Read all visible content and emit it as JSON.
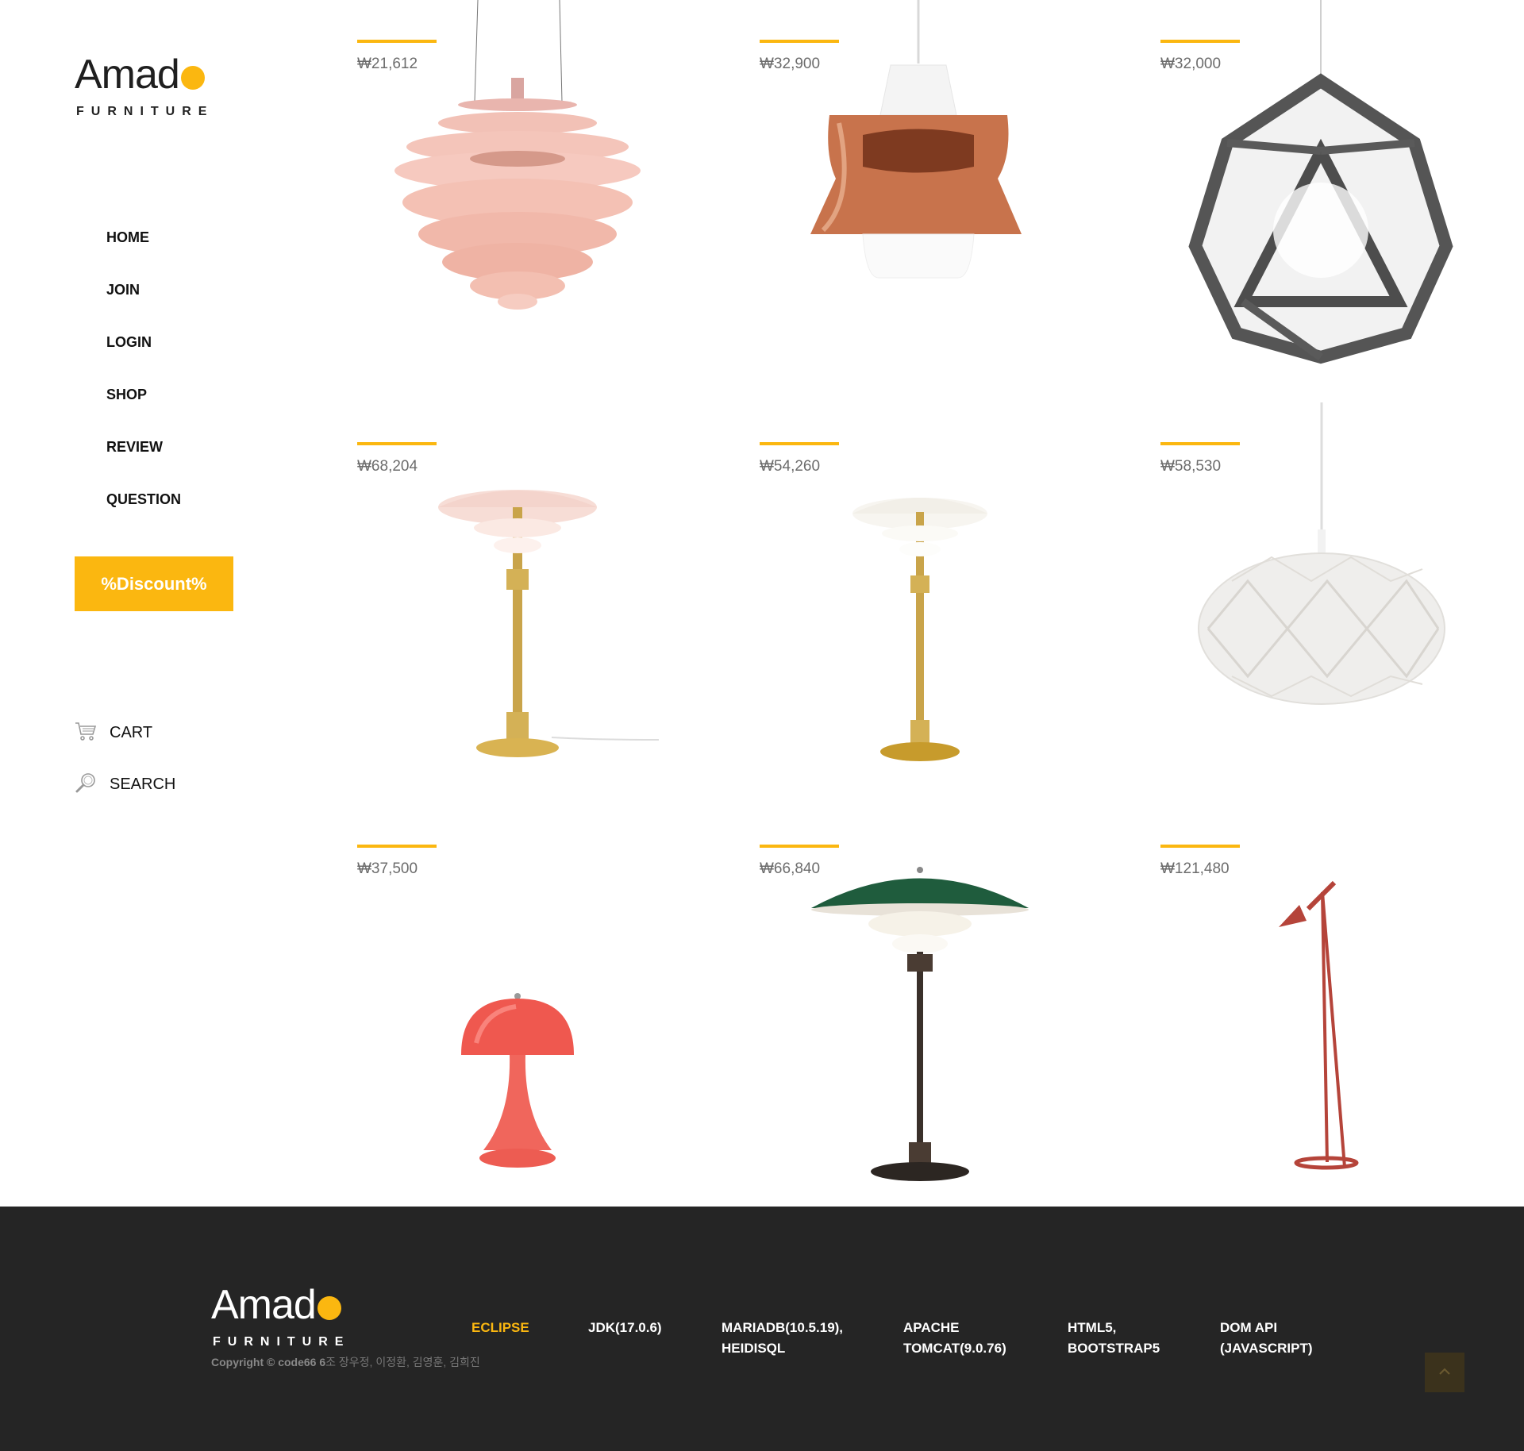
{
  "brand": {
    "name": "Amad",
    "tagline": "FURNITURE",
    "accent": "#fbb710"
  },
  "nav": {
    "items": [
      {
        "label": "HOME"
      },
      {
        "label": "JOIN"
      },
      {
        "label": "LOGIN"
      },
      {
        "label": "SHOP"
      },
      {
        "label": "REVIEW"
      },
      {
        "label": "QUESTION"
      }
    ]
  },
  "discount_label": "%Discount%",
  "utilities": {
    "cart_label": "CART",
    "search_label": "SEARCH"
  },
  "products": [
    {
      "price": "₩21,612",
      "image": "pink-artichoke-pendant"
    },
    {
      "price": "₩32,900",
      "image": "copper-pendant"
    },
    {
      "price": "₩32,000",
      "image": "geometric-pendant"
    },
    {
      "price": "₩68,204",
      "image": "pink-table-lamp"
    },
    {
      "price": "₩54,260",
      "image": "white-table-lamp"
    },
    {
      "price": "₩58,530",
      "image": "oval-pendant"
    },
    {
      "price": "₩37,500",
      "image": "coral-mushroom-lamp"
    },
    {
      "price": "₩66,840",
      "image": "green-table-lamp"
    },
    {
      "price": "₩121,480",
      "image": "red-floor-lamp"
    }
  ],
  "footer": {
    "brand": {
      "name": "Amad",
      "tagline": "FURNITURE"
    },
    "copyright_bold": "Copyright © code66 6",
    "copyright_rest": "조 장우정, 이정환, 김영훈, 김희진",
    "links": [
      {
        "line1": "ECLIPSE",
        "line2": ""
      },
      {
        "line1": "JDK(17.0.6)",
        "line2": ""
      },
      {
        "line1": "MARIADB(10.5.19),",
        "line2": "HEIDISQL"
      },
      {
        "line1": "APACHE",
        "line2": "TOMCAT(9.0.76)"
      },
      {
        "line1": "HTML5,",
        "line2": "BOOTSTRAP5"
      },
      {
        "line1": "DOM API",
        "line2": "(JAVASCRIPT)"
      }
    ]
  }
}
